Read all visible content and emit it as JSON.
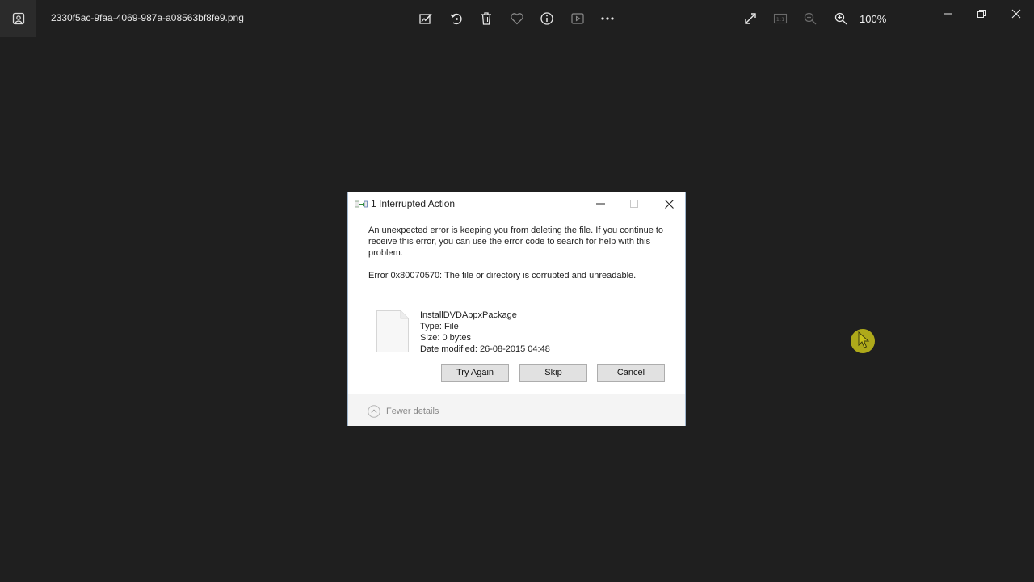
{
  "app": {
    "filename": "2330f5ac-9faa-4069-987a-a08563bf8fe9.png",
    "zoom_level": "100%",
    "toolbar_icons": [
      "edit-image-icon",
      "rotate-icon",
      "delete-icon",
      "favorite-icon",
      "info-icon",
      "slideshow-icon",
      "more-icon"
    ],
    "view_icons": [
      "fullscreen-icon",
      "actual-size-icon",
      "zoom-out-icon",
      "zoom-in-icon"
    ]
  },
  "dialog": {
    "title": "1 Interrupted Action",
    "message": "An unexpected error is keeping you from deleting the file. If you continue to receive this error, you can use the error code to search for help with this problem.",
    "error": "Error 0x80070570: The file or directory is corrupted and unreadable.",
    "file": {
      "name": "InstallDVDAppxPackage",
      "type": "Type: File",
      "size": "Size: 0 bytes",
      "modified": "Date modified: 26-08-2015 04:48"
    },
    "buttons": {
      "try_again": "Try Again",
      "skip": "Skip",
      "cancel": "Cancel"
    },
    "footer_label": "Fewer details"
  },
  "colors": {
    "background": "#1f1f1f",
    "dialog_border": "#9fb5cc",
    "cursor_highlight": "#c8c21a"
  }
}
